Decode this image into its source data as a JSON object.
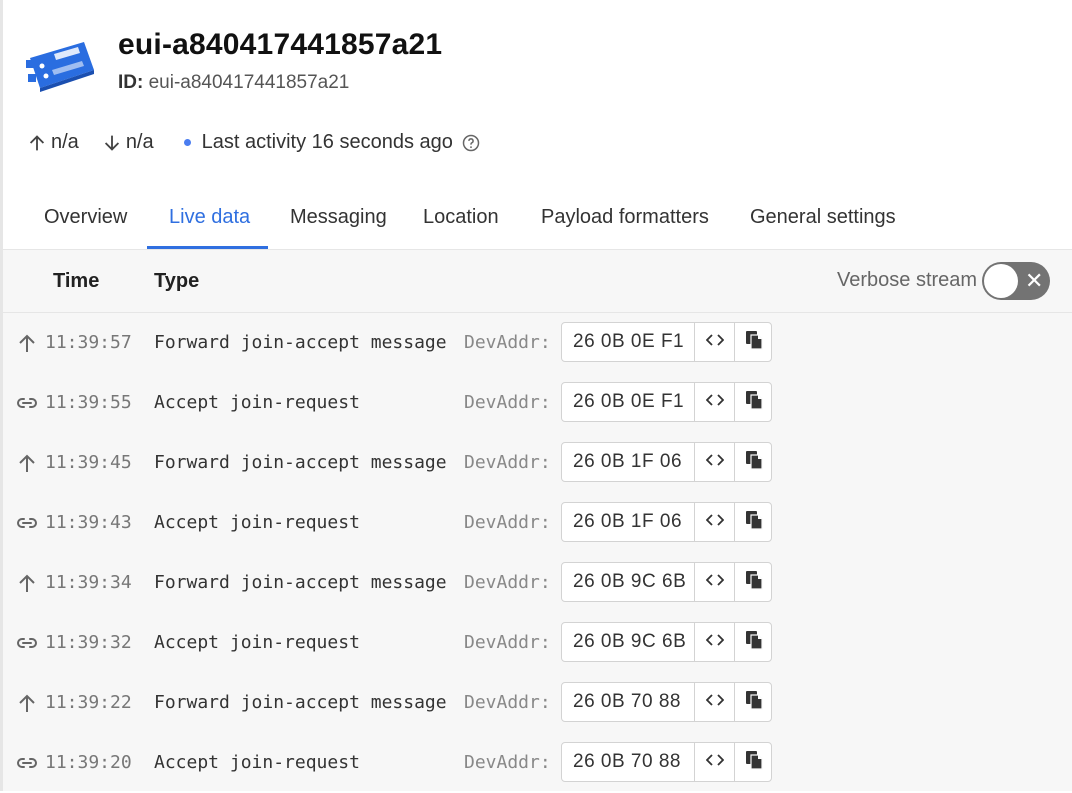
{
  "device": {
    "name": "eui-a840417441857a21",
    "id_label": "ID:",
    "id_value": "eui-a840417441857a21"
  },
  "stats": {
    "uplink": "n/a",
    "downlink": "n/a",
    "activity": "Last activity 16 seconds ago"
  },
  "tabs": [
    {
      "label": "Overview"
    },
    {
      "label": "Live data"
    },
    {
      "label": "Messaging"
    },
    {
      "label": "Location"
    },
    {
      "label": "Payload formatters"
    },
    {
      "label": "General settings"
    }
  ],
  "active_tab": "Live data",
  "table": {
    "col_time": "Time",
    "col_type": "Type",
    "verbose_label": "Verbose stream",
    "verbose_on": false
  },
  "colors": {
    "accent": "#2f6fe0",
    "device_icon": "#2a6de0"
  },
  "events": [
    {
      "icon": "arrow-up-icon",
      "time": "11:39:57",
      "type": "Forward join-accept message",
      "field": "DevAddr:",
      "value": "26 0B 0E F1"
    },
    {
      "icon": "link-icon",
      "time": "11:39:55",
      "type": "Accept join-request",
      "field": "DevAddr:",
      "value": "26 0B 0E F1"
    },
    {
      "icon": "arrow-up-icon",
      "time": "11:39:45",
      "type": "Forward join-accept message",
      "field": "DevAddr:",
      "value": "26 0B 1F 06"
    },
    {
      "icon": "link-icon",
      "time": "11:39:43",
      "type": "Accept join-request",
      "field": "DevAddr:",
      "value": "26 0B 1F 06"
    },
    {
      "icon": "arrow-up-icon",
      "time": "11:39:34",
      "type": "Forward join-accept message",
      "field": "DevAddr:",
      "value": "26 0B 9C 6B"
    },
    {
      "icon": "link-icon",
      "time": "11:39:32",
      "type": "Accept join-request",
      "field": "DevAddr:",
      "value": "26 0B 9C 6B"
    },
    {
      "icon": "arrow-up-icon",
      "time": "11:39:22",
      "type": "Forward join-accept message",
      "field": "DevAddr:",
      "value": "26 0B 70 88"
    },
    {
      "icon": "link-icon",
      "time": "11:39:20",
      "type": "Accept join-request",
      "field": "DevAddr:",
      "value": "26 0B 70 88"
    }
  ]
}
